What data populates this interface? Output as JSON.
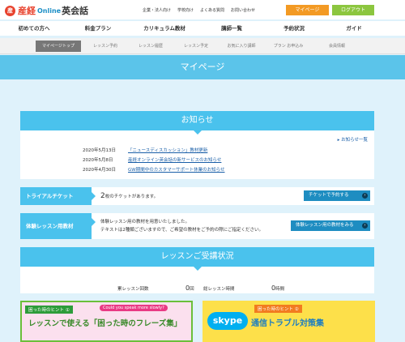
{
  "logo": {
    "mark": "産",
    "part1": "産経",
    "part2": "Online",
    "part3": "英会話"
  },
  "toplinks": [
    "企業・法人向け",
    "学校向け",
    "よくある質問",
    "お問い合わせ"
  ],
  "header_buttons": {
    "mypage": "マイページ",
    "logout": "ログアウト"
  },
  "mainnav": [
    "初めての方へ",
    "料金プラン",
    "カリキュラム教材",
    "講師一覧",
    "予約状況",
    "ガイド"
  ],
  "subnav": [
    "マイページトップ",
    "レッスン予約",
    "レッスン履歴",
    "レッスン予定",
    "お気に入り講師",
    "プラン お申込み",
    "会員情報"
  ],
  "page_title": "マイページ",
  "news": {
    "heading": "お知らせ",
    "all_link": "お知らせ一覧",
    "items": [
      {
        "date": "2020年5月13日",
        "title": "「ニュースディスカッション」教材更新"
      },
      {
        "date": "2020年5月8日",
        "title": "産経オンライン英会話の新サービスのお知らせ"
      },
      {
        "date": "2020年4月30日",
        "title": "GW期間中のカスタマーサポート休業のお知らせ"
      }
    ]
  },
  "trial": {
    "label": "トライアルチケット",
    "count": "2",
    "text": "枚のチケットがあります。",
    "button": "チケットで予約する"
  },
  "material": {
    "label": "体験レッスン用教材",
    "line1": "体験レッスン用の教材を用意いたしました。",
    "line2": "テキストは2種類ございますので、ご希望の教材をご予約の際にご指定ください。",
    "button": "体験レッスン用の教材をみる"
  },
  "lesson_status": {
    "heading": "レッスンご受講状況",
    "count_label": "累レッスン回数",
    "count_value": "0",
    "count_unit": "回",
    "time_label": "総レッスン時間",
    "time_value": "0",
    "time_unit": "時間"
  },
  "banner1": {
    "hint": "困った時のヒント ①",
    "bubble": "Could you speak more slowly?",
    "main": "レッスンで使える「困った時のフレーズ集」"
  },
  "banner2": {
    "logo": "skype",
    "hint": "困った時のヒント ②",
    "main": "通信トラブル対策集"
  },
  "colors": {
    "accent": "#4ac2ed",
    "button": "#1e8dc1",
    "mypage": "#f39a24",
    "logout": "#8cc63f"
  }
}
